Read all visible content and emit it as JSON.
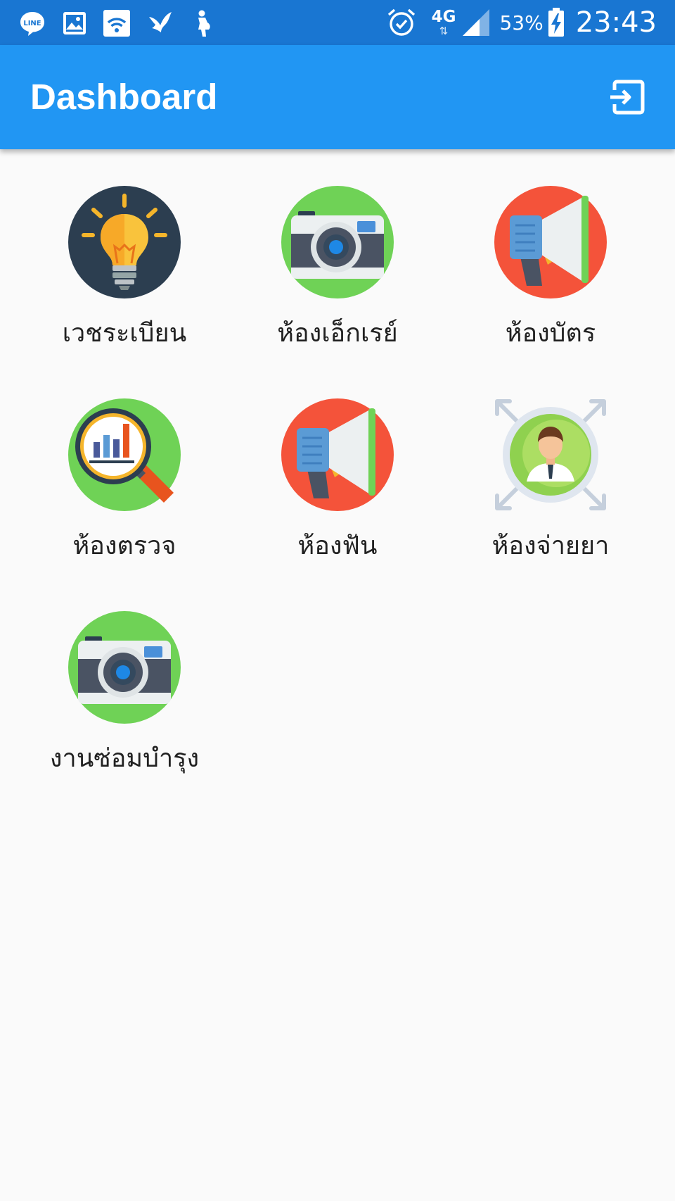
{
  "status_bar": {
    "icons_left": [
      "line-icon",
      "gallery-icon",
      "wifi-icon",
      "bird-icon",
      "maternity-icon"
    ],
    "network": "4G",
    "network_arrows": "⇅",
    "battery": "53%",
    "clock": "23:43"
  },
  "app_bar": {
    "title": "Dashboard",
    "exit_icon": "exit-icon"
  },
  "menu": [
    {
      "label": "เวชระเบียน",
      "icon": "lightbulb-icon"
    },
    {
      "label": "ห้องเอ็กเรย์",
      "icon": "camera-icon"
    },
    {
      "label": "ห้องบัตร",
      "icon": "megaphone-icon"
    },
    {
      "label": "ห้องตรวจ",
      "icon": "analytics-magnifier-icon"
    },
    {
      "label": "ห้องฟัน",
      "icon": "megaphone-icon"
    },
    {
      "label": "ห้องจ่ายยา",
      "icon": "person-icon"
    },
    {
      "label": "งานซ่อมบำรุง",
      "icon": "camera-icon"
    }
  ],
  "colors": {
    "status_bar": "#1976d2",
    "app_bar": "#2196f3",
    "background": "#fafafa",
    "icon_green": "#6fd256",
    "icon_red": "#f4533a",
    "icon_navy": "#2c3e50"
  }
}
